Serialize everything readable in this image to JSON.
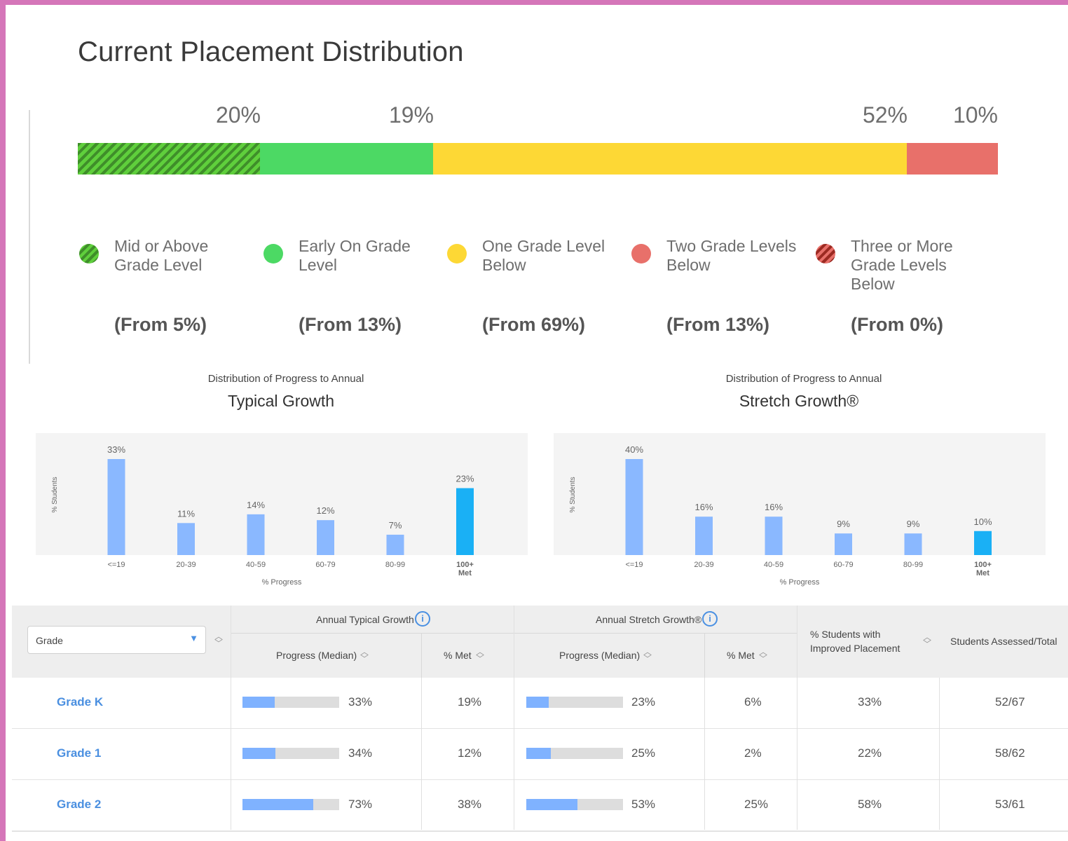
{
  "page_title": "Current Placement Distribution",
  "placement": {
    "segments": [
      {
        "pct_label": "20%",
        "value": 20,
        "style": "hatch-green"
      },
      {
        "pct_label": "19%",
        "value": 19,
        "style": "green"
      },
      {
        "pct_label": "52%",
        "value": 52,
        "style": "yellow"
      },
      {
        "pct_label": "10%",
        "value": 10,
        "style": "red"
      }
    ],
    "legend": [
      {
        "label": "Mid or Above Grade Level",
        "from": "(From 5%)",
        "color": "#4cd964"
      },
      {
        "label": "Early On Grade Level",
        "from": "(From 13%)",
        "color": "#4cd964"
      },
      {
        "label": "One Grade Level Below",
        "from": "(From 69%)",
        "color": "#fdd835"
      },
      {
        "label": "Two Grade Levels Below",
        "from": "(From 13%)",
        "color": "#e8706a"
      },
      {
        "label": "Three or More Grade Levels Below",
        "from": "(From 0%)",
        "color": "#e8706a"
      }
    ]
  },
  "chart_data": [
    {
      "type": "bar",
      "pretitle": "Distribution of Progress to Annual",
      "title": "Typical Growth",
      "ylabel": "% Students",
      "xlabel": "% Progress",
      "categories": [
        "<=19",
        "20-39",
        "40-59",
        "60-79",
        "80-99",
        "100+ Met"
      ],
      "values": [
        33,
        11,
        14,
        12,
        7,
        23
      ],
      "value_labels": [
        "33%",
        "11%",
        "14%",
        "12%",
        "7%",
        "23%"
      ],
      "colors": [
        "#8ab8ff",
        "#8ab8ff",
        "#8ab8ff",
        "#8ab8ff",
        "#8ab8ff",
        "#1ab0f5"
      ],
      "ylim": [
        0,
        33
      ]
    },
    {
      "type": "bar",
      "pretitle": "Distribution of Progress to Annual",
      "title": "Stretch Growth®",
      "ylabel": "% Students",
      "xlabel": "% Progress",
      "categories": [
        "<=19",
        "20-39",
        "40-59",
        "60-79",
        "80-99",
        "100+ Met"
      ],
      "values": [
        40,
        16,
        16,
        9,
        9,
        10
      ],
      "value_labels": [
        "40%",
        "16%",
        "16%",
        "9%",
        "9%",
        "10%"
      ],
      "colors": [
        "#8ab8ff",
        "#8ab8ff",
        "#8ab8ff",
        "#8ab8ff",
        "#8ab8ff",
        "#1ab0f5"
      ],
      "ylim": [
        0,
        40
      ]
    }
  ],
  "table": {
    "grade_select": "Grade",
    "groups": {
      "typical": "Annual Typical Growth",
      "stretch": "Annual Stretch Growth®"
    },
    "headers": {
      "progress_median": "Progress (Median)",
      "pct_met": "% Met",
      "improved_line1": "% Students with",
      "improved_line2": "Improved Placement",
      "assessed": "Students Assessed/Total"
    },
    "rows": [
      {
        "grade": "Grade K",
        "typ_progress": 33,
        "typ_progress_label": "33%",
        "typ_met": "19%",
        "str_progress": 23,
        "str_progress_label": "23%",
        "str_met": "6%",
        "improved": "33%",
        "assessed": "52/67"
      },
      {
        "grade": "Grade 1",
        "typ_progress": 34,
        "typ_progress_label": "34%",
        "typ_met": "12%",
        "str_progress": 25,
        "str_progress_label": "25%",
        "str_met": "2%",
        "improved": "22%",
        "assessed": "58/62"
      },
      {
        "grade": "Grade 2",
        "typ_progress": 73,
        "typ_progress_label": "73%",
        "typ_met": "38%",
        "str_progress": 53,
        "str_progress_label": "53%",
        "str_met": "25%",
        "improved": "58%",
        "assessed": "53/61"
      }
    ]
  }
}
